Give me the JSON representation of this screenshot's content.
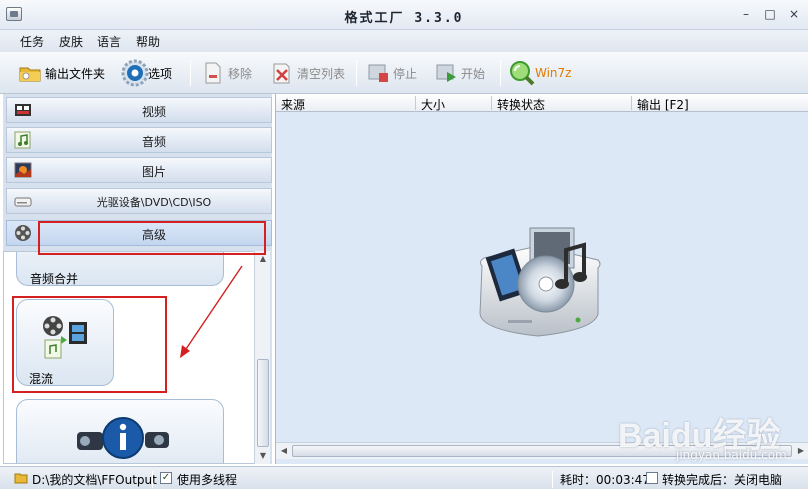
{
  "window": {
    "title": "格式工厂  3.3.0",
    "minimize": "–",
    "maximize": "□",
    "close": "×"
  },
  "menu": {
    "items": [
      "任务",
      "皮肤",
      "语言",
      "帮助"
    ]
  },
  "toolbar": {
    "output_folder": "输出文件夹",
    "options": "选项",
    "remove": "移除",
    "clear_list": "清空列表",
    "stop": "停止",
    "start": "开始",
    "win7z": "Win7z"
  },
  "categories": [
    "视频",
    "音频",
    "图片",
    "光驱设备\\DVD\\CD\\ISO",
    "高级"
  ],
  "advanced_items": {
    "audio_merge": "音频合并",
    "mux": "混流"
  },
  "table": {
    "headers": [
      "来源",
      "大小",
      "转换状态",
      "输出 [F2]"
    ]
  },
  "status": {
    "output_path": "D:\\我的文档\\FFOutput",
    "multithread": "使用多线程",
    "elapsed": "耗时：00:03:47",
    "after_convert": "转换完成后：关闭电脑"
  },
  "watermark": {
    "main": "Baidu经验",
    "sub": "jingyan.baidu.com"
  },
  "colors": {
    "highlight_box": "#d42020",
    "accent_orange": "#e07b00",
    "win7z_green": "#2f9a2f"
  }
}
